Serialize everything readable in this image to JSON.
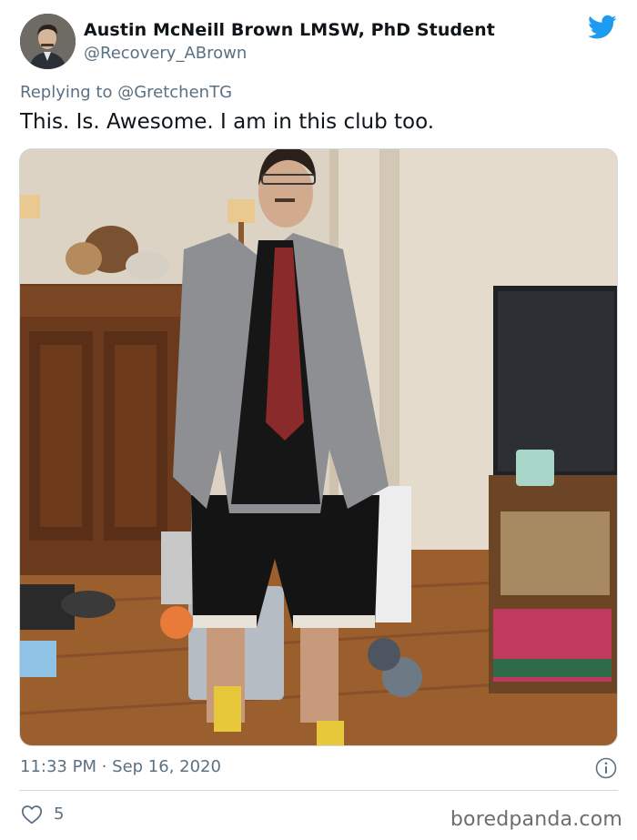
{
  "author": {
    "name": "Austin McNeill Brown LMSW, PhD Student",
    "handle": "@Recovery_ABrown",
    "avatar_icon": "avatar"
  },
  "tweet": {
    "reply_to": "Replying to @GretchenTG",
    "text": "This. Is. Awesome. I am in this club too.",
    "timestamp": "11:33 PM · Sep 16, 2020",
    "like_count": "5"
  },
  "icons": {
    "platform": "twitter-bird-icon",
    "info": "info-icon",
    "like": "heart-icon"
  },
  "colors": {
    "twitter_blue": "#1d9bf0",
    "secondary_text": "#5b7083",
    "primary_text": "#0f1419",
    "divider": "#cfd9de"
  },
  "watermark": "boredpanda.com"
}
